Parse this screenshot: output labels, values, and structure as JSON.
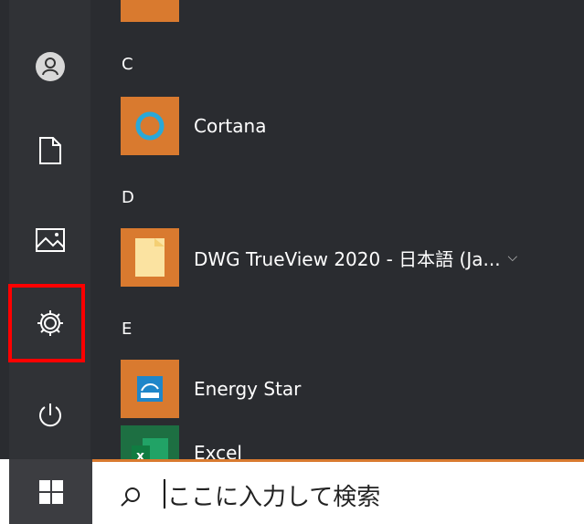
{
  "start_menu": {
    "sections": [
      {
        "letter": "C",
        "apps": [
          {
            "label": "Cortana",
            "icon": "cortana-ring-icon"
          }
        ]
      },
      {
        "letter": "D",
        "apps": [
          {
            "label": "DWG TrueView 2020 - 日本語 (Ja...",
            "icon": "folder-icon",
            "has_submenu": true
          }
        ]
      },
      {
        "letter": "E",
        "apps": [
          {
            "label": "Energy Star",
            "icon": "energy-star-icon"
          },
          {
            "label": "Excel",
            "icon": "excel-icon"
          }
        ]
      }
    ],
    "rail": [
      {
        "name": "user-avatar-icon"
      },
      {
        "name": "documents-icon"
      },
      {
        "name": "pictures-icon"
      },
      {
        "name": "settings-gear-icon",
        "highlighted": true
      },
      {
        "name": "power-icon"
      }
    ],
    "submenu_chevron": "⌵"
  },
  "taskbar": {
    "search_placeholder": "ここに入力して検索"
  },
  "colors": {
    "rail_bg": "#303236",
    "list_bg": "#2a2c30",
    "tile_orange": "#d97a2f",
    "highlight_red": "#ff0000"
  }
}
